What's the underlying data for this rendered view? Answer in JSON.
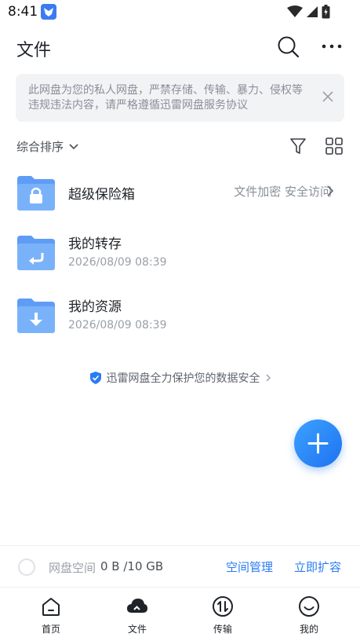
{
  "status_bar": {
    "time": "8:41",
    "app_icon": "thunder-bird-icon",
    "icons": [
      "wifi-icon",
      "signal-icon",
      "battery-icon"
    ]
  },
  "header": {
    "title": "文件",
    "search_icon": "search-icon",
    "more_icon": "more-icon"
  },
  "notice": {
    "text": "此网盘为您的私人网盘，严禁存储、传输、暴力、侵权等违规违法内容，请严格遵循迅雷网盘服务协议",
    "close_icon": "close-icon"
  },
  "toolbar": {
    "sort_label": "综合排序",
    "sort_icon": "chevron-down-icon",
    "filter_icon": "filter-icon",
    "view_icon": "grid-view-icon"
  },
  "files": [
    {
      "name": "超级保险箱",
      "hint": "文件加密 安全访问",
      "icon": "vault-folder-icon"
    },
    {
      "name": "我的转存",
      "date": "2026/08/09 08:39",
      "icon": "transfer-folder-icon"
    },
    {
      "name": "我的资源",
      "date": "2026/08/09 08:39",
      "icon": "download-folder-icon"
    }
  ],
  "security_note": {
    "text": "迅雷网盘全力保护您的数据安全",
    "icon": "shield-check-icon"
  },
  "fab": {
    "icon": "plus-icon"
  },
  "storage": {
    "label": "网盘空间",
    "value": "0 B /10 GB",
    "manage_label": "空间管理",
    "expand_label": "立即扩容"
  },
  "tabs": [
    {
      "label": "首页",
      "icon": "home-icon"
    },
    {
      "label": "文件",
      "icon": "cloud-icon",
      "active": true
    },
    {
      "label": "传输",
      "icon": "transfer-icon"
    },
    {
      "label": "我的",
      "icon": "smile-icon"
    }
  ],
  "colors": {
    "accent": "#2b7cf3",
    "folder": "#6aa6f8",
    "notice_bg": "#f2f3f5"
  }
}
